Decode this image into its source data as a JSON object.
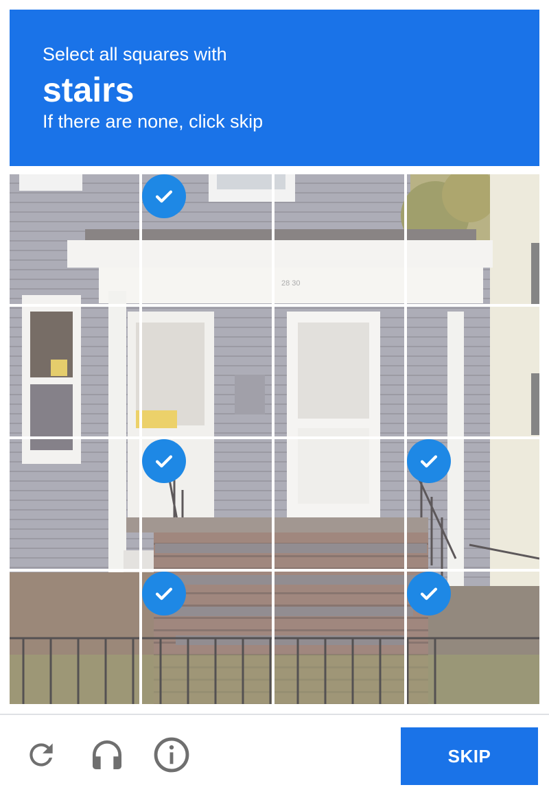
{
  "header": {
    "instruction": "Select all squares with",
    "target": "stairs",
    "hint": "If there are none, click skip",
    "background": "#1a73e8"
  },
  "grid": {
    "rows": 4,
    "columns": 4,
    "image_content": "photo of a grey two-door house porch with front steps and a railing",
    "selected_tiles": [
      {
        "row": 0,
        "col": 1
      },
      {
        "row": 2,
        "col": 1
      },
      {
        "row": 2,
        "col": 3
      },
      {
        "row": 3,
        "col": 1
      },
      {
        "row": 3,
        "col": 3
      }
    ],
    "check_color": "#1e88e5"
  },
  "footer": {
    "controls": [
      "reload-icon",
      "audio-headphones-icon",
      "info-icon"
    ],
    "skip_label": "SKIP",
    "skip_color": "#1a73e8"
  }
}
